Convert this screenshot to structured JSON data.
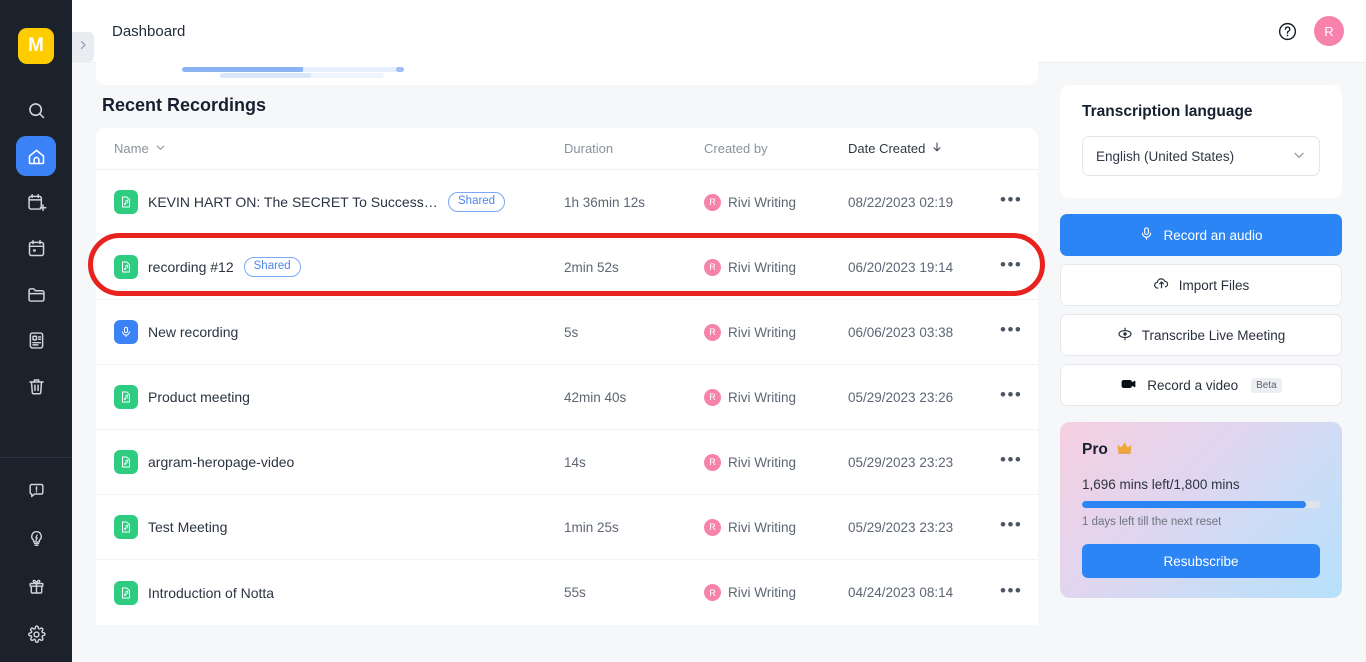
{
  "app": {
    "logo_letter": "M",
    "collapse_icon": "chevron-right-icon"
  },
  "sidebar": {
    "items": [
      {
        "name": "search",
        "icon": "search-icon",
        "active": false
      },
      {
        "name": "home",
        "icon": "home-icon",
        "active": true
      },
      {
        "name": "new-meeting",
        "icon": "calendar-add-icon",
        "active": false
      },
      {
        "name": "calendar",
        "icon": "calendar-icon",
        "active": false
      },
      {
        "name": "folders",
        "icon": "folder-icon",
        "active": false
      },
      {
        "name": "notes",
        "icon": "document-icon",
        "active": false
      },
      {
        "name": "trash",
        "icon": "trash-icon",
        "active": false
      }
    ],
    "bottom_items": [
      {
        "name": "feedback",
        "icon": "feedback-icon"
      },
      {
        "name": "tips",
        "icon": "lightbulb-icon"
      },
      {
        "name": "rewards",
        "icon": "gift-icon"
      },
      {
        "name": "settings",
        "icon": "gear-icon"
      }
    ]
  },
  "topbar": {
    "title": "Dashboard",
    "help_icon": "help-circle-icon",
    "avatar_letter": "R"
  },
  "main": {
    "section_title": "Recent Recordings",
    "columns": [
      {
        "label": "Name",
        "sort_icon": "chevron-down-icon",
        "sorted": false
      },
      {
        "label": "Duration",
        "sort_icon": "",
        "sorted": false
      },
      {
        "label": "Created by",
        "sort_icon": "",
        "sorted": false
      },
      {
        "label": "Date Created",
        "sort_icon": "arrow-down-icon",
        "sorted": true
      }
    ],
    "rows": [
      {
        "icon": "audio-file-icon",
        "icon_kind": "audio",
        "name": "KEVIN HART ON: The SECRET To Success &...",
        "badge": "Shared",
        "duration": "1h 36min 12s",
        "created_by": "Rivi Writing",
        "created_by_initial": "R",
        "date": "08/22/2023 02:19",
        "menu": "•••",
        "highlighted": true
      },
      {
        "icon": "audio-file-icon",
        "icon_kind": "audio",
        "name": "recording #12",
        "badge": "Shared",
        "duration": "2min 52s",
        "created_by": "Rivi Writing",
        "created_by_initial": "R",
        "date": "06/20/2023 19:14",
        "menu": "•••",
        "highlighted": false
      },
      {
        "icon": "microphone-file-icon",
        "icon_kind": "mic",
        "name": "New recording",
        "badge": "",
        "duration": "5s",
        "created_by": "Rivi Writing",
        "created_by_initial": "R",
        "date": "06/06/2023 03:38",
        "menu": "•••",
        "highlighted": false
      },
      {
        "icon": "audio-file-icon",
        "icon_kind": "audio",
        "name": "Product meeting",
        "badge": "",
        "duration": "42min 40s",
        "created_by": "Rivi Writing",
        "created_by_initial": "R",
        "date": "05/29/2023 23:26",
        "menu": "•••",
        "highlighted": false
      },
      {
        "icon": "audio-file-icon",
        "icon_kind": "audio",
        "name": "argram-heropage-video",
        "badge": "",
        "duration": "14s",
        "created_by": "Rivi Writing",
        "created_by_initial": "R",
        "date": "05/29/2023 23:23",
        "menu": "•••",
        "highlighted": false
      },
      {
        "icon": "audio-file-icon",
        "icon_kind": "audio",
        "name": "Test Meeting",
        "badge": "",
        "duration": "1min 25s",
        "created_by": "Rivi Writing",
        "created_by_initial": "R",
        "date": "05/29/2023 23:23",
        "menu": "•••",
        "highlighted": false
      },
      {
        "icon": "audio-file-icon",
        "icon_kind": "audio",
        "name": "Introduction of Notta",
        "badge": "",
        "duration": "55s",
        "created_by": "Rivi Writing",
        "created_by_initial": "R",
        "date": "04/24/2023 08:14",
        "menu": "•••",
        "highlighted": false
      }
    ]
  },
  "right_panel": {
    "language_card": {
      "title": "Transcription language",
      "selected": "English (United States)",
      "chevron_icon": "chevron-down-icon"
    },
    "actions": [
      {
        "label": "Record an audio",
        "icon": "microphone-icon",
        "style": "primary",
        "tag": ""
      },
      {
        "label": "Import Files",
        "icon": "upload-cloud-icon",
        "style": "ghost",
        "tag": ""
      },
      {
        "label": "Transcribe Live Meeting",
        "icon": "live-meeting-icon",
        "style": "ghost",
        "tag": ""
      },
      {
        "label": "Record a video",
        "icon": "video-camera-icon",
        "style": "ghost",
        "tag": "Beta"
      }
    ],
    "pro_card": {
      "title": "Pro",
      "crown_icon": "crown-icon",
      "minutes": "1,696 mins left/1,800 mins",
      "progress_percent": 94,
      "reset_note": "1 days left till the next reset",
      "cta": "Resubscribe"
    }
  },
  "annotation": {
    "shape": "rounded-rectangle-highlight",
    "color": "#e8231f",
    "target": "KEVIN HART ON: The SECRET To Success &..."
  },
  "colors": {
    "accent_blue": "#2b85f5",
    "rail_bg": "#1b222c",
    "logo_yellow": "#ffcc00",
    "avatar_pink": "#f783ac",
    "audio_green": "#2ecc80",
    "annotation_red": "#e8231f"
  }
}
